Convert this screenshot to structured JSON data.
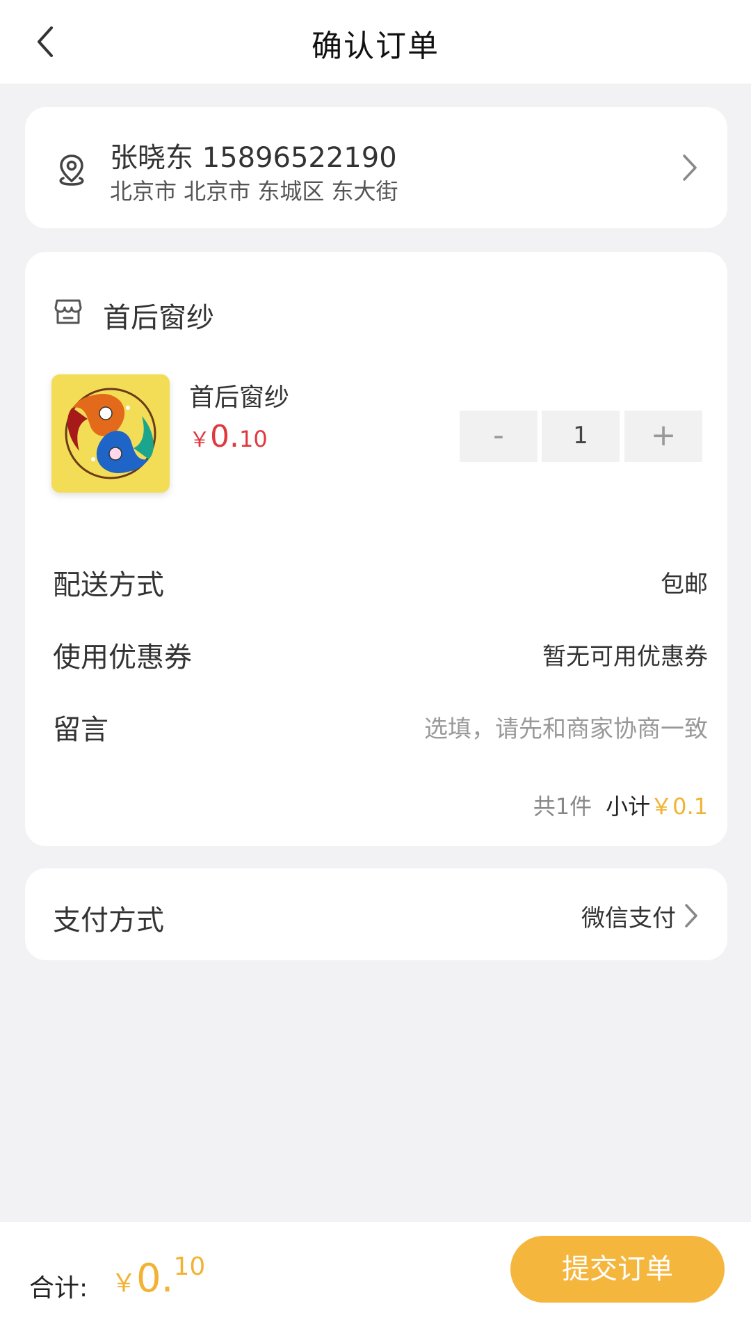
{
  "header": {
    "title": "确认订单"
  },
  "address": {
    "name_phone": "张晓东 15896522190",
    "detail": "北京市 北京市 东城区 东大街"
  },
  "shop": {
    "name": "首后窗纱"
  },
  "goods": {
    "title": "首后窗纱",
    "price_symbol": "￥",
    "price_int": "0.",
    "price_dec": "10",
    "quantity": "1",
    "minus_label": "-",
    "plus_label": "+"
  },
  "rows": {
    "delivery_label": "配送方式",
    "delivery_value": "包邮",
    "coupon_label": "使用优惠券",
    "coupon_value": "暂无可用优惠券",
    "message_label": "留言",
    "message_placeholder": "选填，请先和商家协商一致"
  },
  "subtotal": {
    "count": "共1件",
    "label": "小计",
    "amount": "￥0.1"
  },
  "payment": {
    "label": "支付方式",
    "value": "微信支付"
  },
  "footer": {
    "total_label": "合计:",
    "price_symbol": "￥",
    "price_int": "0.",
    "price_dec": "10",
    "submit_label": "提交订单"
  },
  "colors": {
    "accent": "#f5b63e",
    "price_red": "#e0383e",
    "background": "#f2f2f4"
  },
  "icons": {
    "back": "chevron-left-icon",
    "location": "location-pin-icon",
    "shop": "shop-icon",
    "address_arrow": "chevron-right-icon",
    "payment_arrow": "chevron-right-icon"
  }
}
